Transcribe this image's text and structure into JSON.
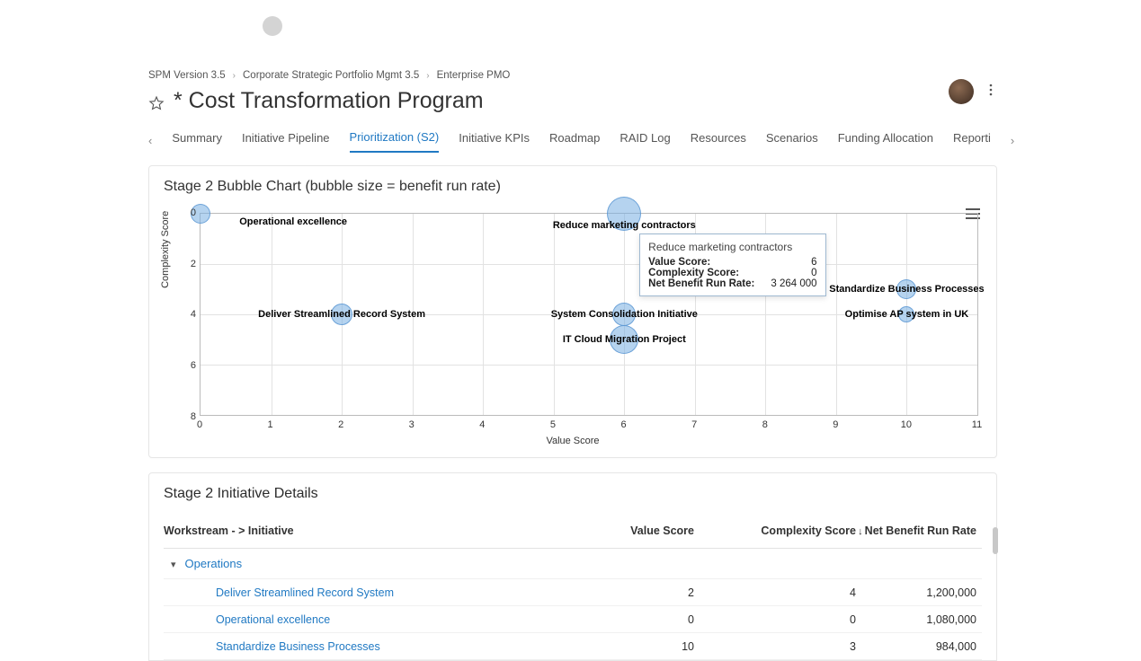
{
  "breadcrumb": {
    "items": [
      "SPM Version 3.5",
      "Corporate Strategic Portfolio Mgmt 3.5",
      "Enterprise PMO"
    ]
  },
  "page": {
    "title": "* Cost Transformation Program"
  },
  "tabs": {
    "items": [
      "Summary",
      "Initiative Pipeline",
      "Prioritization (S2)",
      "Initiative KPIs",
      "Roadmap",
      "RAID Log",
      "Resources",
      "Scenarios",
      "Funding Allocation",
      "Reporti"
    ],
    "active_index": 2
  },
  "chart_card": {
    "title": "Stage 2 Bubble Chart (bubble size = benefit run rate)",
    "xlabel": "Value Score",
    "ylabel": "Complexity Score"
  },
  "chart_data": {
    "type": "scatter",
    "xlabel": "Value Score",
    "ylabel": "Complexity Score",
    "xlim": [
      0,
      11
    ],
    "ylim": [
      0,
      8
    ],
    "y_inverted": true,
    "x_ticks": [
      0,
      1,
      2,
      3,
      4,
      5,
      6,
      7,
      8,
      9,
      10,
      11
    ],
    "y_ticks": [
      0,
      2,
      4,
      6,
      8
    ],
    "size_meaning": "Net Benefit Run Rate",
    "series": [
      {
        "name": "Initiatives",
        "points": [
          {
            "label": "Operational excellence",
            "x": 0,
            "y": 0,
            "size": 1080000
          },
          {
            "label": "Reduce marketing contractors",
            "x": 6,
            "y": 0,
            "size": 3264000
          },
          {
            "label": "Deliver Streamlined Record System",
            "x": 2,
            "y": 4,
            "size": 1200000
          },
          {
            "label": "System Consolidation Initiative",
            "x": 6,
            "y": 4,
            "size": 1600000
          },
          {
            "label": "IT Cloud Migration Project",
            "x": 6,
            "y": 5,
            "size": 2200000
          },
          {
            "label": "Standardize Business Processes",
            "x": 10,
            "y": 3,
            "size": 984000
          },
          {
            "label": "Optimise AP system in UK",
            "x": 10,
            "y": 4,
            "size": 700000
          }
        ]
      }
    ],
    "tooltip": {
      "title": "Reduce marketing contractors",
      "rows": [
        {
          "k": "Value Score:",
          "v": "6"
        },
        {
          "k": "Complexity Score:",
          "v": "0"
        },
        {
          "k": "Net Benefit Run Rate:",
          "v": "3 264 000"
        }
      ]
    }
  },
  "details": {
    "title": "Stage 2 Initiative Details",
    "headers": {
      "workstream": "Workstream - > Initiative",
      "value": "Value Score",
      "complexity": "Complexity Score",
      "net": "Net Benefit Run Rate"
    },
    "sort_indicator": "↓",
    "group": {
      "name": "Operations"
    },
    "rows": [
      {
        "name": "Deliver Streamlined Record System",
        "value": "2",
        "complexity": "4",
        "net": "1,200,000"
      },
      {
        "name": "Operational excellence",
        "value": "0",
        "complexity": "0",
        "net": "1,080,000"
      },
      {
        "name": "Standardize Business Processes",
        "value": "10",
        "complexity": "3",
        "net": "984,000"
      }
    ]
  }
}
